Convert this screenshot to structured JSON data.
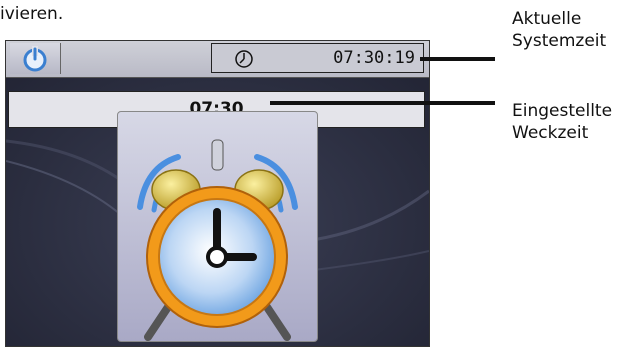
{
  "page": {
    "top_fragment": "ivieren."
  },
  "device": {
    "status_bar": {
      "power_icon": "power-icon",
      "clock_icon": "clock-icon",
      "system_time": "07:30:19"
    },
    "alarm_time": "07:30",
    "alarm_icon": "alarm-clock-icon"
  },
  "annotations": {
    "system_time": [
      "Aktuelle",
      "Systemzeit"
    ],
    "alarm_time": [
      "Eingestellte",
      "Weckzeit"
    ]
  },
  "colors": {
    "accent_blue": "#3a7fd0",
    "alarm_orange": "#f29a1a",
    "bell_gold": "#d8c04a"
  }
}
